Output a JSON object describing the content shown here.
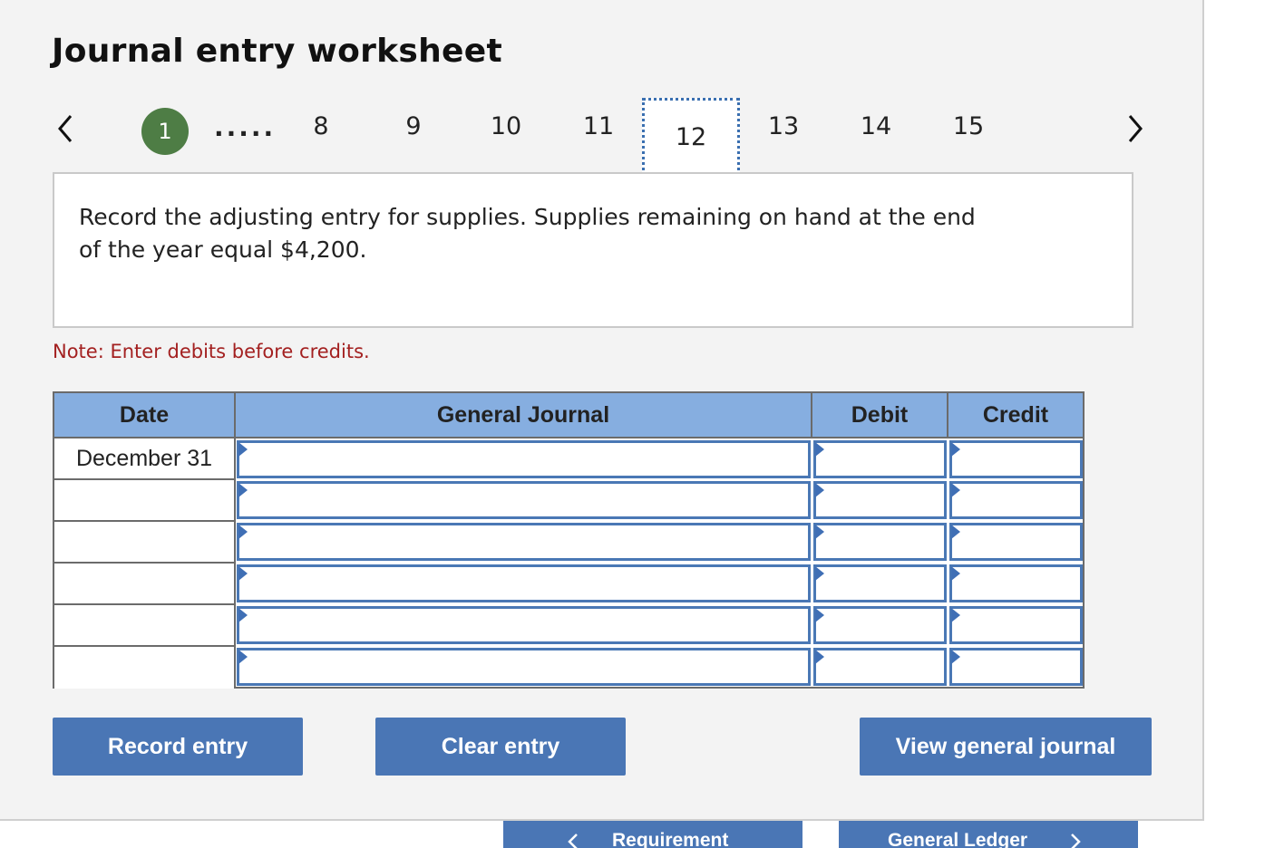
{
  "page": {
    "title": "Journal entry worksheet"
  },
  "pager": {
    "first_step": "1",
    "ellipsis": ".....",
    "steps": [
      "8",
      "9",
      "10",
      "11"
    ],
    "current": "12",
    "steps_after": [
      "13",
      "14",
      "15"
    ]
  },
  "question": {
    "text_line1": "Record the adjusting entry for supplies. Supplies remaining on hand at the end",
    "text_line2": "of the year equal $4,200."
  },
  "note": "Note: Enter debits before credits.",
  "journal": {
    "headers": {
      "date": "Date",
      "account": "General Journal",
      "debit": "Debit",
      "credit": "Credit"
    },
    "rows": [
      {
        "date": "December 31",
        "account": "",
        "debit": "",
        "credit": ""
      },
      {
        "date": "",
        "account": "",
        "debit": "",
        "credit": ""
      },
      {
        "date": "",
        "account": "",
        "debit": "",
        "credit": ""
      },
      {
        "date": "",
        "account": "",
        "debit": "",
        "credit": ""
      },
      {
        "date": "",
        "account": "",
        "debit": "",
        "credit": ""
      },
      {
        "date": "",
        "account": "",
        "debit": "",
        "credit": ""
      }
    ]
  },
  "buttons": {
    "record": "Record entry",
    "clear": "Clear entry",
    "view": "View general journal",
    "requirement": "Requirement",
    "ledger": "General Ledger"
  },
  "colors": {
    "accent": "#4a76b5",
    "header": "#86aee0",
    "note": "#a32020",
    "step_badge": "#4e7d45"
  }
}
